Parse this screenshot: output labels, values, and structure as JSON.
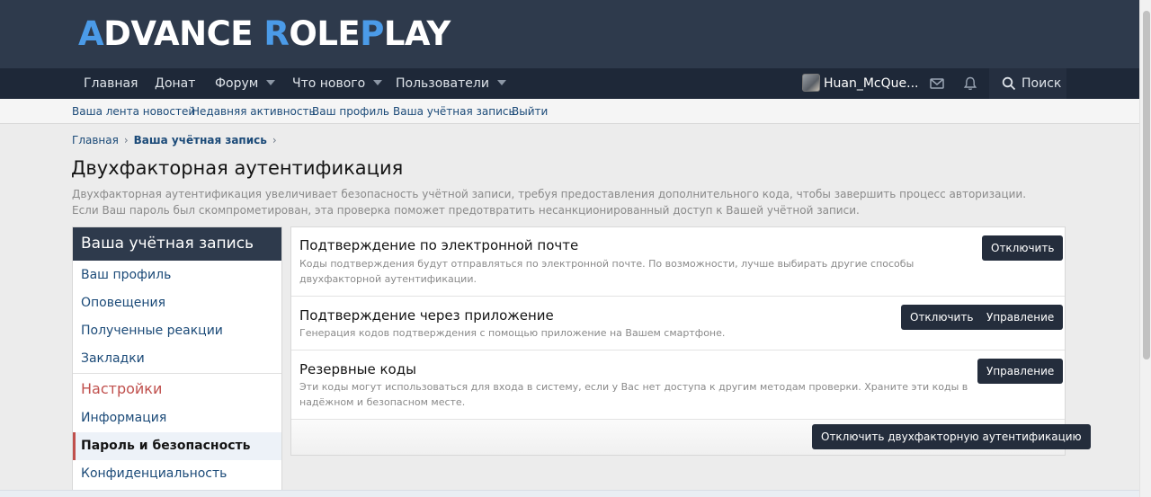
{
  "logo": {
    "part1": "A",
    "part2": "DVANCE ",
    "part3": "R",
    "part4": "OLE",
    "part5": "P",
    "part6": "LAY"
  },
  "nav": {
    "items": [
      {
        "label": "Главная"
      },
      {
        "label": "Донат"
      },
      {
        "label": "Форум"
      },
      {
        "label": "Что нового"
      },
      {
        "label": "Пользователи"
      }
    ],
    "user_name": "Huan_McQue...",
    "search_label": "Поиск",
    "icons": [
      "mail-icon",
      "bell-icon",
      "search-icon"
    ]
  },
  "subnav": {
    "items": [
      {
        "label": "Ваша лента новостей"
      },
      {
        "label": "Недавняя активность"
      },
      {
        "label": "Ваш профиль"
      },
      {
        "label": "Ваша учётная запись"
      },
      {
        "label": "Выйти"
      }
    ]
  },
  "breadcrumb": {
    "home": "Главная",
    "current": "Ваша учётная запись"
  },
  "page": {
    "title": "Двухфакторная аутентификация",
    "description": "Двухфакторная аутентификация увеличивает безопасность учётной записи, требуя предоставления дополнительного кода, чтобы завершить процесс авторизации. Если Ваш пароль был скомпрометирован, эта проверка поможет предотвратить несанкционированный доступ к Вашей учётной записи."
  },
  "sidebar": {
    "title": "Ваша учётная запись",
    "items": [
      {
        "label": "Ваш профиль"
      },
      {
        "label": "Оповещения"
      },
      {
        "label": "Полученные реакции"
      },
      {
        "label": "Закладки"
      }
    ],
    "section": "Настройки",
    "settings_items": [
      {
        "label": "Информация"
      },
      {
        "label": "Пароль и безопасность"
      },
      {
        "label": "Конфиденциальность"
      }
    ]
  },
  "methods": [
    {
      "title": "Подтверждение по электронной почте",
      "description": "Коды подтверждения будут отправляться по электронной почте. По возможности, лучше выбирать другие способы двухфакторной аутентификации.",
      "buttons": [
        "Отключить"
      ]
    },
    {
      "title": "Подтверждение через приложение",
      "description": "Генерация кодов подтверждения с помощью приложение на Вашем смартфоне.",
      "buttons": [
        "Отключить",
        "Управление"
      ]
    },
    {
      "title": "Резервные коды",
      "description": "Эти коды могут использоваться для входа в систему, если у Вас нет доступа к другим методам проверки. Храните эти коды в надёжном и безопасном месте.",
      "buttons": [
        "Управление"
      ]
    }
  ],
  "footer_button": "Отключить двухфакторную аутентификацию",
  "colors": {
    "header": "#2e3a4c",
    "navbar": "#1e2838",
    "accent": "#4b9be8",
    "button": "#242d3c",
    "section": "#c0504d",
    "link": "#1b4a78"
  }
}
